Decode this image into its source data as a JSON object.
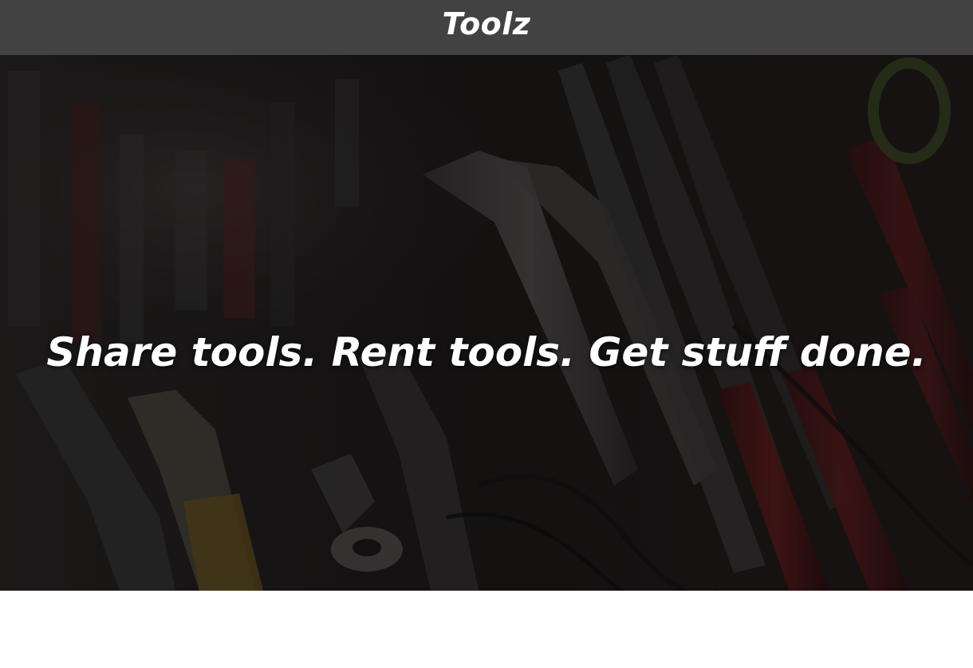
{
  "header": {
    "brand": "Toolz"
  },
  "hero": {
    "tagline": "Share tools. Rent tools. Get stuff done.",
    "background_image": "tools-workshop-photo"
  },
  "colors": {
    "header_bg": "#424242",
    "hero_overlay": "#1c1a1a",
    "text": "#ffffff"
  }
}
